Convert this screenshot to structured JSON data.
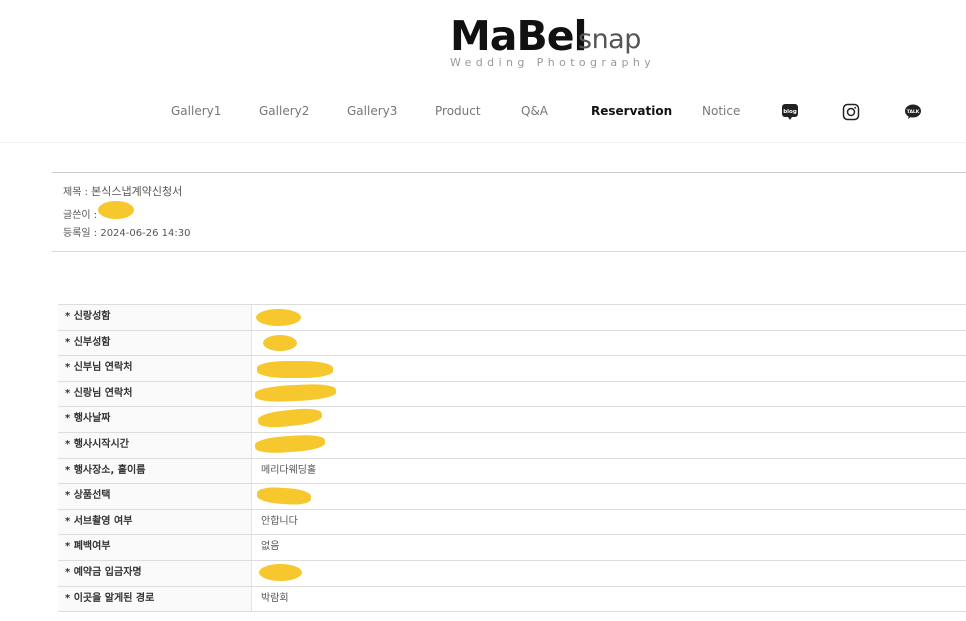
{
  "brand": {
    "name_main": "MaBel",
    "name_sub": "snap",
    "tagline": "Wedding Photography"
  },
  "nav": {
    "items": [
      {
        "label": "Gallery1",
        "active": false
      },
      {
        "label": "Gallery2",
        "active": false
      },
      {
        "label": "Gallery3",
        "active": false
      },
      {
        "label": "Product",
        "active": false
      },
      {
        "label": "Q&A",
        "active": false
      },
      {
        "label": "Reservation",
        "active": true
      },
      {
        "label": "Notice",
        "active": false
      }
    ],
    "icons": [
      "blog-icon",
      "instagram-icon",
      "kakaotalk-icon"
    ],
    "blog_icon_text": "blog",
    "talk_icon_text": "TALK"
  },
  "post": {
    "title_label": "제목 : ",
    "title_value": "본식스냅계약신청서",
    "author_label": "글쓴이 : ",
    "author_value": "",
    "date_label": "등록일 : ",
    "date_value": "2024-06-26 14:30"
  },
  "form": {
    "rows": [
      {
        "label": "* 신랑성함",
        "value": ""
      },
      {
        "label": "* 신부성함",
        "value": ""
      },
      {
        "label": "* 신부님 연락처",
        "value": ""
      },
      {
        "label": "* 신랑님 연락처",
        "value": ""
      },
      {
        "label": "* 행사날짜",
        "value": ""
      },
      {
        "label": "* 행사시작시간",
        "value": ""
      },
      {
        "label": "* 행사장소, 홀이름",
        "value": "메리다웨딩홀"
      },
      {
        "label": "* 상품선택",
        "value": ""
      },
      {
        "label": "* 서브촬영 여부",
        "value": "안합니다"
      },
      {
        "label": "* 폐백여부",
        "value": "없음"
      },
      {
        "label": "* 예약금 입금자명",
        "value": ""
      },
      {
        "label": "* 이곳을 알게된 경로",
        "value": "박람회"
      }
    ]
  },
  "colors": {
    "redaction": "#f7c72e",
    "active_nav": "#111111",
    "nav": "#777777"
  }
}
